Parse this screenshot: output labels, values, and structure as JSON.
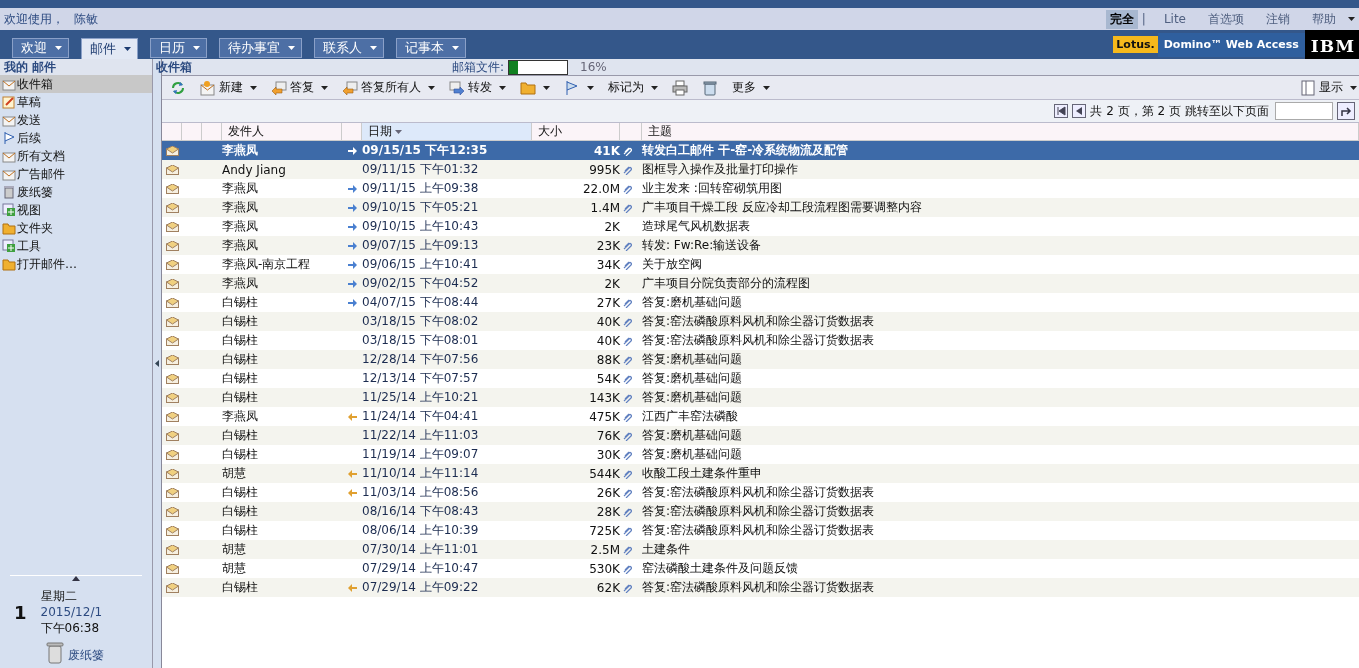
{
  "header": {
    "welcome": "欢迎使用，",
    "user": "陈敏",
    "links": [
      {
        "label": "完全",
        "selected": true
      },
      {
        "label": "Lite",
        "selected": false
      },
      {
        "label": "首选项",
        "selected": false
      },
      {
        "label": "注销",
        "selected": false
      },
      {
        "label": "帮助",
        "selected": false,
        "dropdown": true
      }
    ],
    "separator": "|"
  },
  "tabs": [
    {
      "label": "欢迎",
      "selected": false
    },
    {
      "label": "邮件",
      "selected": true
    },
    {
      "label": "日历",
      "selected": false
    },
    {
      "label": "待办事宜",
      "selected": false
    },
    {
      "label": "联系人",
      "selected": false
    },
    {
      "label": "记事本",
      "selected": false
    }
  ],
  "brand": {
    "lotus": "Lotus.",
    "product": "Domino™ Web Access",
    "ibm": "IBM"
  },
  "sidebar": {
    "title": "我的 邮件",
    "items": [
      {
        "label": "收件箱",
        "kind": "inbox",
        "selected": true
      },
      {
        "label": "草稿",
        "kind": "drafts",
        "selected": false
      },
      {
        "label": "发送",
        "kind": "sent",
        "selected": false
      },
      {
        "label": "后续",
        "kind": "flag",
        "selected": false
      },
      {
        "label": "所有文档",
        "kind": "inbox",
        "selected": false
      },
      {
        "label": "广告邮件",
        "kind": "junk",
        "selected": false
      },
      {
        "label": "废纸篓",
        "kind": "trash",
        "selected": false
      },
      {
        "label": "视图",
        "kind": "plus",
        "selected": false
      },
      {
        "label": "文件夹",
        "kind": "folder",
        "selected": false
      },
      {
        "label": "工具",
        "kind": "plus",
        "selected": false
      },
      {
        "label": "打开邮件…",
        "kind": "folder",
        "selected": false
      }
    ],
    "day": "1",
    "weekday": "星期二",
    "date": "2015/12/1",
    "time": "下午06:38",
    "trash": "废纸篓"
  },
  "view": {
    "title": "收件箱",
    "quota_label": "邮箱文件:",
    "quota": {
      "level": 0.16
    },
    "quota_reading": "16%"
  },
  "toolbar": {
    "buttons": [
      {
        "kind": "refresh",
        "dropdown": false
      },
      {
        "kind": "new",
        "label": "新建",
        "dropdown": true
      },
      {
        "kind": "reply",
        "label": "答复",
        "dropdown": true
      },
      {
        "kind": "reply-all",
        "label": "答复所有人",
        "dropdown": true
      },
      {
        "kind": "forward",
        "label": "转发",
        "dropdown": true
      },
      {
        "kind": "folder",
        "dropdown": true
      },
      {
        "kind": "flag",
        "dropdown": true
      },
      {
        "label": "标记为",
        "dropdown": true
      },
      {
        "kind": "print",
        "dropdown": false
      },
      {
        "kind": "trash",
        "dropdown": false
      },
      {
        "label": "更多",
        "dropdown": true
      }
    ],
    "display": "显示"
  },
  "pager": {
    "info": "共 2 页，第 2 页",
    "goto": "跳转至以下页面"
  },
  "table": {
    "columns": [
      {
        "label": "发件人",
        "sorted": false
      },
      {
        "label": "日期",
        "sorted": true
      },
      {
        "label": "大小",
        "sorted": false
      },
      {
        "label": "主题",
        "sorted": false
      }
    ],
    "rows": [
      {
        "sender": "李燕凤",
        "kind": "forwarded",
        "date": "09/15/15 下午12:35",
        "size": "41K",
        "attachment": true,
        "subject": "转发白工邮件  干-窑-冷系统物流及配管",
        "selected": true
      },
      {
        "sender": "Andy Jiang",
        "kind": "plain",
        "date": "09/11/15 下午01:32",
        "size": "995K",
        "attachment": true,
        "subject": "图框导入操作及批量打印操作",
        "selected": false
      },
      {
        "sender": "李燕凤",
        "kind": "forwarded",
        "date": "09/11/15 上午09:38",
        "size": "22.0M",
        "attachment": true,
        "subject": "业主发来 :回转窑砌筑用图",
        "selected": false
      },
      {
        "sender": "李燕凤",
        "kind": "forwarded",
        "date": "09/10/15 下午05:21",
        "size": "1.4M",
        "attachment": true,
        "subject": "广丰项目干燥工段 反应冷却工段流程图需要调整内容",
        "selected": false
      },
      {
        "sender": "李燕凤",
        "kind": "forwarded",
        "date": "09/10/15 上午10:43",
        "size": "2K",
        "attachment": false,
        "subject": "造球尾气风机数据表",
        "selected": false
      },
      {
        "sender": "李燕凤",
        "kind": "forwarded",
        "date": "09/07/15 上午09:13",
        "size": "23K",
        "attachment": true,
        "subject": "转发: Fw:Re:输送设备",
        "selected": false
      },
      {
        "sender": "李燕凤-南京工程",
        "kind": "forwarded",
        "date": "09/06/15 上午10:41",
        "size": "34K",
        "attachment": true,
        "subject": "关于放空阀",
        "selected": false
      },
      {
        "sender": "李燕凤",
        "kind": "forwarded",
        "date": "09/02/15 下午04:52",
        "size": "2K",
        "attachment": false,
        "subject": "广丰项目分院负责部分的流程图",
        "selected": false
      },
      {
        "sender": "白锡柱",
        "kind": "forwarded",
        "date": "04/07/15 下午08:44",
        "size": "27K",
        "attachment": true,
        "subject": "答复:磨机基础问题",
        "selected": false
      },
      {
        "sender": "白锡柱",
        "kind": "plain",
        "date": "03/18/15 下午08:02",
        "size": "40K",
        "attachment": true,
        "subject": "答复:窑法磷酸原料风机和除尘器订货数据表",
        "selected": false
      },
      {
        "sender": "白锡柱",
        "kind": "plain",
        "date": "03/18/15 下午08:01",
        "size": "40K",
        "attachment": true,
        "subject": "答复:窑法磷酸原料风机和除尘器订货数据表",
        "selected": false
      },
      {
        "sender": "白锡柱",
        "kind": "plain",
        "date": "12/28/14 下午07:56",
        "size": "88K",
        "attachment": true,
        "subject": "答复:磨机基础问题",
        "selected": false
      },
      {
        "sender": "白锡柱",
        "kind": "plain",
        "date": "12/13/14 下午07:57",
        "size": "54K",
        "attachment": true,
        "subject": "答复:磨机基础问题",
        "selected": false
      },
      {
        "sender": "白锡柱",
        "kind": "plain",
        "date": "11/25/14 上午10:21",
        "size": "143K",
        "attachment": true,
        "subject": "答复:磨机基础问题",
        "selected": false
      },
      {
        "sender": "李燕凤",
        "kind": "replied",
        "date": "11/24/14 下午04:41",
        "size": "475K",
        "attachment": true,
        "subject": "江西广丰窑法磷酸",
        "selected": false
      },
      {
        "sender": "白锡柱",
        "kind": "plain",
        "date": "11/22/14 上午11:03",
        "size": "76K",
        "attachment": true,
        "subject": "答复:磨机基础问题",
        "selected": false
      },
      {
        "sender": "白锡柱",
        "kind": "plain",
        "date": "11/19/14 上午09:07",
        "size": "30K",
        "attachment": true,
        "subject": "答复:磨机基础问题",
        "selected": false
      },
      {
        "sender": "胡慧",
        "kind": "replied",
        "date": "11/10/14 上午11:14",
        "size": "544K",
        "attachment": true,
        "subject": "收酸工段土建条件重申",
        "selected": false
      },
      {
        "sender": "白锡柱",
        "kind": "replied",
        "date": "11/03/14 上午08:56",
        "size": "26K",
        "attachment": true,
        "subject": "答复:窑法磷酸原料风机和除尘器订货数据表",
        "selected": false
      },
      {
        "sender": "白锡柱",
        "kind": "plain",
        "date": "08/16/14 下午08:43",
        "size": "28K",
        "attachment": true,
        "subject": "答复:窑法磷酸原料风机和除尘器订货数据表",
        "selected": false
      },
      {
        "sender": "白锡柱",
        "kind": "plain",
        "date": "08/06/14 上午10:39",
        "size": "725K",
        "attachment": true,
        "subject": "答复:窑法磷酸原料风机和除尘器订货数据表",
        "selected": false
      },
      {
        "sender": "胡慧",
        "kind": "plain",
        "date": "07/30/14 上午11:01",
        "size": "2.5M",
        "attachment": true,
        "subject": "土建条件",
        "selected": false
      },
      {
        "sender": "胡慧",
        "kind": "plain",
        "date": "07/29/14 上午10:47",
        "size": "530K",
        "attachment": true,
        "subject": "窑法磷酸土建条件及问题反馈",
        "selected": false
      },
      {
        "sender": "白锡柱",
        "kind": "replied",
        "date": "07/29/14 上午09:22",
        "size": "62K",
        "attachment": true,
        "subject": "答复:窑法磷酸原料风机和除尘器订货数据表",
        "selected": false
      }
    ]
  }
}
